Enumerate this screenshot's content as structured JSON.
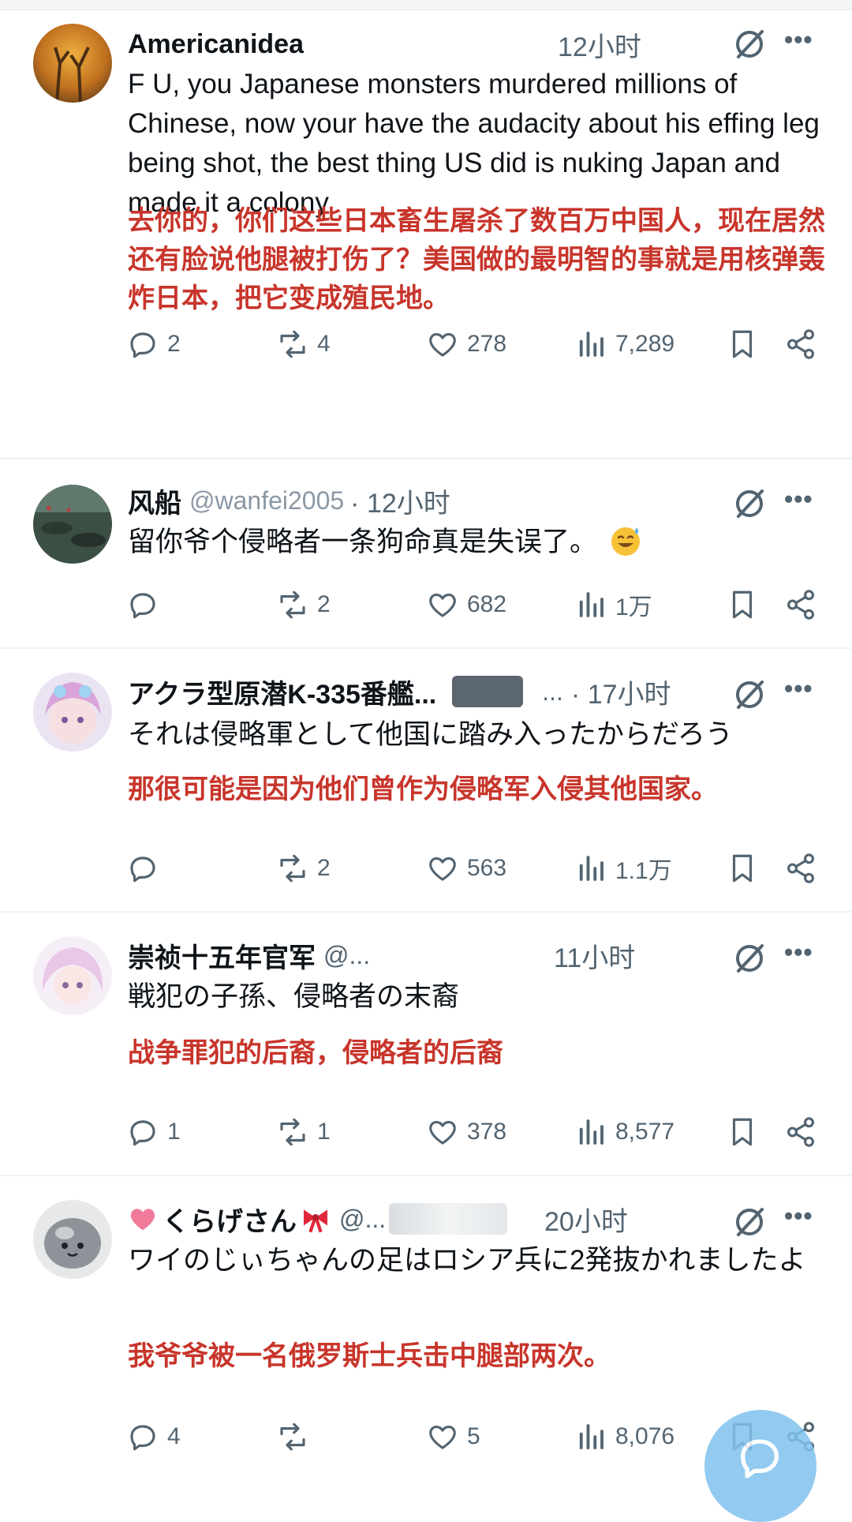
{
  "colors": {
    "accent": "#1d9bf0",
    "translation": "#c8352b",
    "muted": "#536471",
    "text": "#0f1419"
  },
  "tweets": [
    {
      "name": "Americanidea",
      "handle": "",
      "time": "12小时",
      "text": "F U, you Japanese monsters murdered millions of Chinese, now your have the audacity about his effing leg being shot, the best thing US did is nuking Japan and made it a colony",
      "translation": "去你的，你们这些日本畜生屠杀了数百万中国人，现在居然还有脸说他腿被打伤了？美国做的最明智的事就是用核弹轰炸日本，把它变成殖民地。",
      "replies": "2",
      "reposts": "4",
      "likes": "278",
      "views": "7,289"
    },
    {
      "name": "风船",
      "handle": "@wanfei2005",
      "time": "· 12小时",
      "text": "留你爷个侵略者一条狗命真是失误了。",
      "emoji": "sweat-smile-emoji",
      "translation": "",
      "replies": "",
      "reposts": "2",
      "likes": "682",
      "views": "1万"
    },
    {
      "name": "アクラ型原潜K-335番艦...",
      "handle": "...",
      "time": "· 17小时",
      "text": "それは侵略軍として他国に踏み入ったからだろう",
      "translation": "那很可能是因为他们曾作为侵略军入侵其他国家。",
      "replies": "",
      "reposts": "2",
      "likes": "563",
      "views": "1.1万"
    },
    {
      "name": "崇祯十五年官军",
      "handle": "@...",
      "time": "11小时",
      "text": "戦犯の子孫、侵略者の末裔",
      "translation": "战争罪犯的后裔，侵略者的后裔",
      "replies": "1",
      "reposts": "1",
      "likes": "378",
      "views": "8,577"
    },
    {
      "name": "くらげさん",
      "handle": "@...",
      "time": "20小时",
      "text": "ワイのじぃちゃんの足はロシア兵に2発抜かれましたよ",
      "translation": "我爷爷被一名俄罗斯士兵击中腿部两次。",
      "replies": "4",
      "reposts": "",
      "likes": "5",
      "views": "8,076"
    }
  ]
}
